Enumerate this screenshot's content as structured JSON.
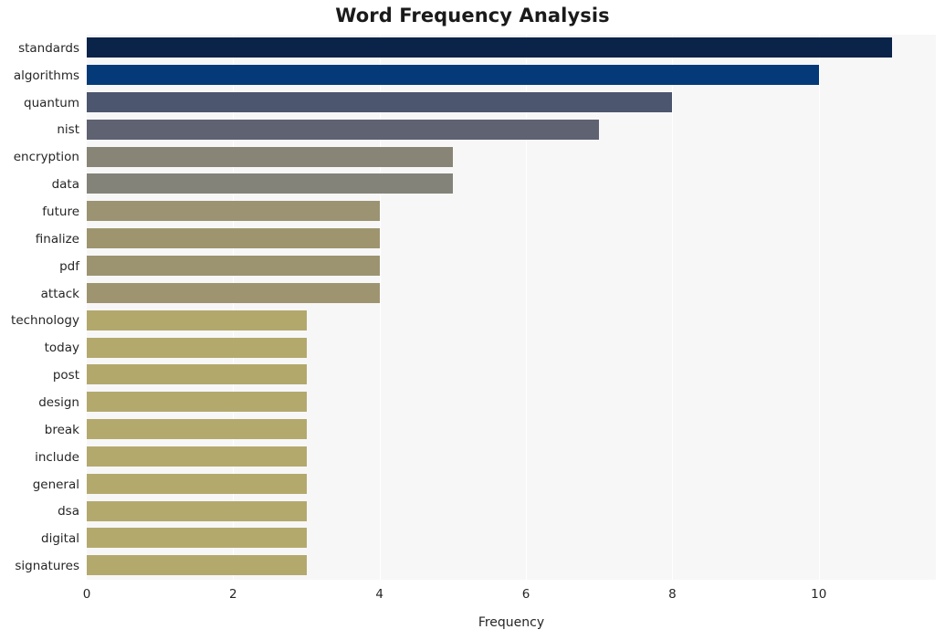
{
  "chart_data": {
    "type": "bar",
    "orientation": "horizontal",
    "title": "Word Frequency Analysis",
    "xlabel": "Frequency",
    "ylabel": "",
    "xlim": [
      0,
      11.6
    ],
    "ylim_categories_top_to_bottom": true,
    "grid": "vertical-only",
    "legend": "none",
    "xticks": [
      0,
      2,
      4,
      6,
      8,
      10
    ],
    "xtick_labels": [
      "0",
      "2",
      "4",
      "6",
      "8",
      "10"
    ],
    "categories": [
      "standards",
      "algorithms",
      "quantum",
      "nist",
      "encryption",
      "data",
      "future",
      "finalize",
      "pdf",
      "attack",
      "technology",
      "today",
      "post",
      "design",
      "break",
      "include",
      "general",
      "dsa",
      "digital",
      "signatures"
    ],
    "values": [
      11,
      10,
      8,
      7,
      5,
      5,
      4,
      4,
      4,
      4,
      3,
      3,
      3,
      3,
      3,
      3,
      3,
      3,
      3,
      3
    ],
    "bar_colors": [
      "#0a2348",
      "#043a78",
      "#4c566f",
      "#5e6271",
      "#888576",
      "#84837a",
      "#9b9371",
      "#9e956f",
      "#9c9470",
      "#9e9570",
      "#b3a86c",
      "#b4a96d",
      "#b3a86c",
      "#b4a96d",
      "#b4a96d",
      "#b4a96d",
      "#b4a96d",
      "#b4a96d",
      "#b4a96d",
      "#b4a96d"
    ]
  },
  "style": {
    "plot_background": "#f7f7f8",
    "figure_background": "#ffffff",
    "gridline_color": "#ffffff",
    "text_color": "#262626",
    "title_color": "#1a1a1a"
  }
}
